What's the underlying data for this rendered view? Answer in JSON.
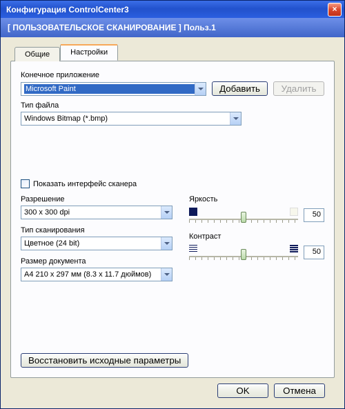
{
  "title": "Конфигурация ControlCenter3",
  "header": "[  ПОЛЬЗОВАТЕЛЬСКОЕ СКАНИРОВАНИЕ  ]   Польз.1",
  "tabs": {
    "general": "Общие",
    "settings": "Настройки"
  },
  "labels": {
    "target_app": "Конечное приложение",
    "file_type": "Тип файла",
    "show_scanner_ui": "Показать интерфейс сканера",
    "resolution": "Разрешение",
    "scan_type": "Тип сканирования",
    "doc_size": "Размер документа",
    "brightness": "Яркость",
    "contrast": "Контраст"
  },
  "values": {
    "target_app": "Microsoft Paint",
    "file_type": "Windows Bitmap (*.bmp)",
    "resolution": "300 x 300 dpi",
    "scan_type": "Цветное (24 bit)",
    "doc_size": "A4 210 x 297 мм (8.3 x 11.7 дюймов)",
    "brightness": "50",
    "contrast": "50"
  },
  "buttons": {
    "add": "Добавить",
    "delete": "Удалить",
    "restore": "Восстановить исходные параметры",
    "ok": "OK",
    "cancel": "Отмена"
  }
}
